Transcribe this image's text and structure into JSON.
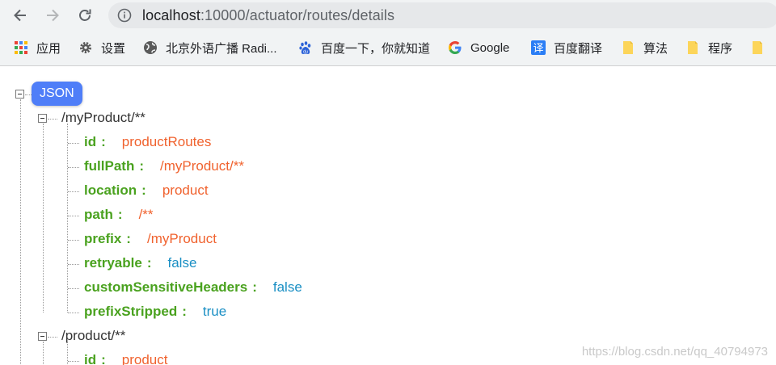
{
  "browser": {
    "url_host": "localhost",
    "url_path": ":10000/actuator/routes/details",
    "bookmarks": [
      {
        "label": "应用",
        "icon": "apps-grid-icon"
      },
      {
        "label": "设置",
        "icon": "gear-icon"
      },
      {
        "label": "北京外语广播 Radi...",
        "icon": "globe-icon"
      },
      {
        "label": "百度一下，你就知道",
        "icon": "baidu-paw-icon"
      },
      {
        "label": "Google",
        "icon": "google-icon"
      },
      {
        "label": "百度翻译",
        "icon": "translate-icon"
      },
      {
        "label": "算法",
        "icon": "folder-icon"
      },
      {
        "label": "程序",
        "icon": "folder-icon"
      }
    ],
    "colors": {
      "chrome_bg": "#f1f3f4",
      "omnibox_bg": "#e6e8ea"
    }
  },
  "viewer": {
    "root_label": "JSON",
    "routes": [
      {
        "key": "/myProduct/**",
        "props": [
          {
            "key": "id",
            "value": "productRoutes",
            "type": "string"
          },
          {
            "key": "fullPath",
            "value": "/myProduct/**",
            "type": "string"
          },
          {
            "key": "location",
            "value": "product",
            "type": "string"
          },
          {
            "key": "path",
            "value": "/**",
            "type": "string"
          },
          {
            "key": "prefix",
            "value": "/myProduct",
            "type": "string"
          },
          {
            "key": "retryable",
            "value": "false",
            "type": "boolean"
          },
          {
            "key": "customSensitiveHeaders",
            "value": "false",
            "type": "boolean"
          },
          {
            "key": "prefixStripped",
            "value": "true",
            "type": "boolean"
          }
        ]
      },
      {
        "key": "/product/**",
        "props": [
          {
            "key": "id",
            "value": "product",
            "type": "string"
          }
        ]
      }
    ],
    "colors": {
      "key": "#4aa21f",
      "string": "#f0622e",
      "boolean": "#1a8fc4",
      "badge": "#4f7ef8"
    }
  },
  "watermark": "https://blog.csdn.net/qq_40794973"
}
